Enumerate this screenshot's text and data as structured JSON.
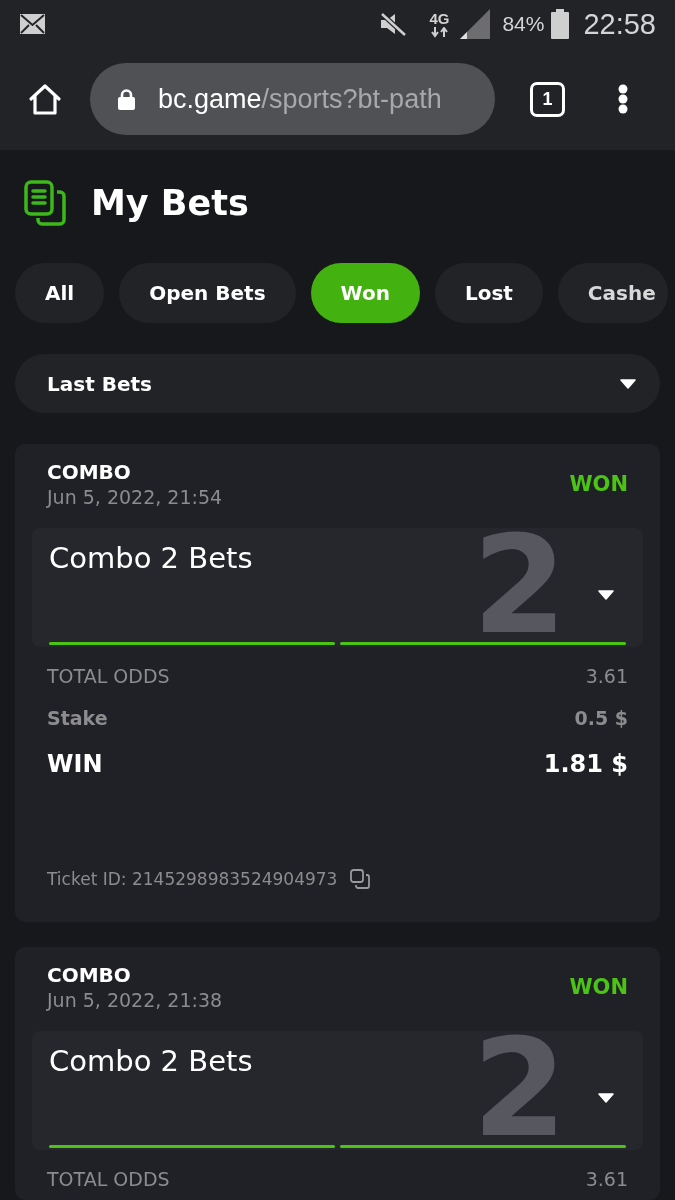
{
  "status_bar": {
    "network": "4G",
    "battery": "84%",
    "time": "22:58"
  },
  "browser": {
    "url_host": "bc.game",
    "url_path": "/sports?bt-path",
    "tab_count": "1"
  },
  "page": {
    "title": "My Bets"
  },
  "tabs": [
    {
      "label": "All",
      "selected": false
    },
    {
      "label": "Open Bets",
      "selected": false
    },
    {
      "label": "Won",
      "selected": true
    },
    {
      "label": "Lost",
      "selected": false
    },
    {
      "label": "Cashe",
      "selected": false
    }
  ],
  "filter": {
    "value": "Last Bets"
  },
  "bets": [
    {
      "type": "COMBO",
      "date": "Jun 5, 2022, 21:54",
      "status": "WON",
      "summary": "Combo 2 Bets",
      "leg_count": "2",
      "legs": [
        {
          "won": true
        },
        {
          "won": true
        }
      ],
      "details": [
        {
          "kind": "odds",
          "label": "TOTAL ODDS",
          "value": "3.61"
        },
        {
          "kind": "stake",
          "label": "Stake",
          "value": "0.5 $"
        },
        {
          "kind": "win",
          "label": "WIN",
          "value": "1.81 $"
        }
      ],
      "ticket_id": "Ticket ID: 2145298983524904973"
    },
    {
      "type": "COMBO",
      "date": "Jun 5, 2022, 21:38",
      "status": "WON",
      "summary": "Combo 2 Bets",
      "leg_count": "2",
      "legs": [
        {
          "won": true
        },
        {
          "won": true
        }
      ],
      "details": [
        {
          "kind": "odds",
          "label": "TOTAL ODDS",
          "value": "3.61"
        }
      ]
    }
  ]
}
